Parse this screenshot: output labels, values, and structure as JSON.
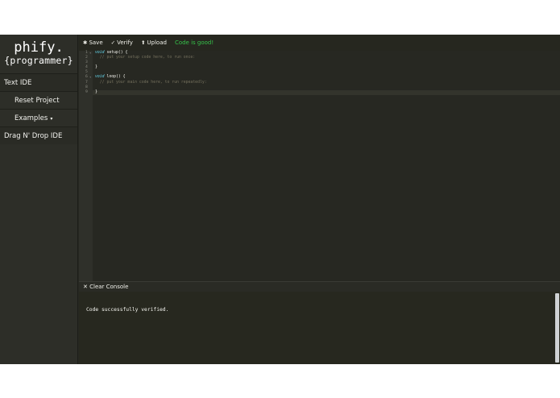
{
  "logo": {
    "line1": "phify.",
    "line2": "{programmer}"
  },
  "sidebar": {
    "items": [
      {
        "label": "Text IDE"
      },
      {
        "label": "Reset Project"
      },
      {
        "label": "Examples",
        "caret": "▾"
      },
      {
        "label": "Drag N' Drop IDE"
      }
    ]
  },
  "toolbar": {
    "save": "Save",
    "save_icon": "✱",
    "verify": "Verify",
    "verify_icon": "✓",
    "upload": "Upload",
    "upload_icon": "⬆",
    "status": "Code is good!",
    "status_color": "#36c24a"
  },
  "editor": {
    "line_numbers": [
      "1",
      "2",
      "3",
      "4",
      "5",
      "6",
      "7",
      "8",
      "9"
    ],
    "lines": {
      "l1_kw": "void",
      "l1_rest": " setup() {",
      "l2": "  // put your setup code here, to run once:",
      "l4": "}",
      "l6_kw": "void",
      "l6_rest": " loop() {",
      "l7": "  // put your main code here, to run repeatedly:",
      "l9": "}"
    }
  },
  "console": {
    "clear_label": "Clear Console",
    "clear_icon": "✕",
    "output": "Code successfully verified."
  },
  "colors": {
    "background": "#272822",
    "sidebar": "#2d2e28",
    "keyword": "#66d9ef",
    "comment": "#75715e"
  }
}
